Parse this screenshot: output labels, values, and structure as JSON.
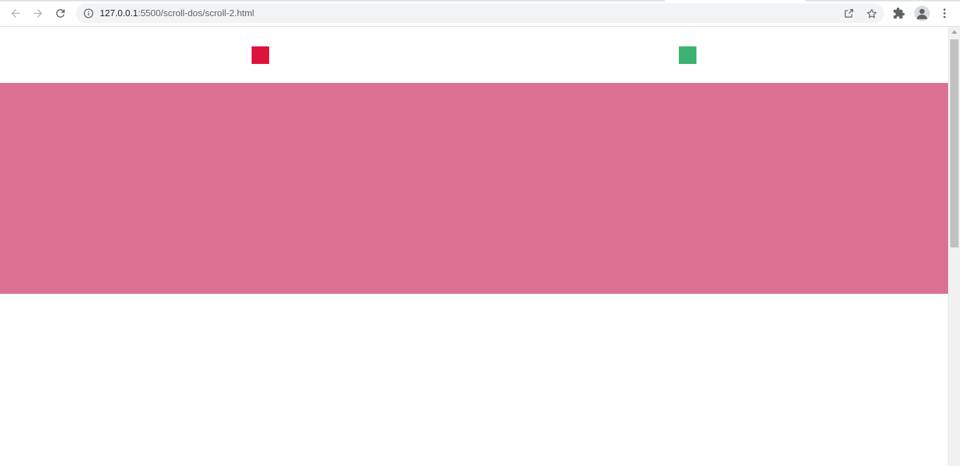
{
  "browser": {
    "url_host": "127.0.0.1",
    "url_path": ":5500/scroll-dos/scroll-2.html",
    "icons": {
      "back": "arrow-left-icon",
      "forward": "arrow-right-icon",
      "reload": "reload-icon",
      "site_info": "info-icon",
      "share": "share-icon",
      "bookmark": "star-icon",
      "extensions": "puzzle-icon",
      "profile": "account-icon",
      "menu": "kebab-menu-icon"
    }
  },
  "page": {
    "colors": {
      "square_red": "#dc143c",
      "square_green": "#3cb371",
      "band": "#db7093"
    }
  },
  "scrollbar": {
    "scroll_position_fraction": 0.0
  }
}
